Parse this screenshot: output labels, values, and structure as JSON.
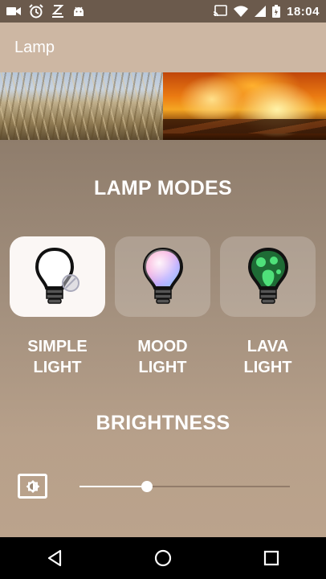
{
  "status_bar": {
    "time": "18:04",
    "left_icons": [
      "video-camera-icon",
      "alarm-clock-icon",
      "sleep-icon",
      "android-icon"
    ],
    "right_icons": [
      "cast-icon",
      "wifi-icon",
      "signal-icon",
      "battery-icon"
    ]
  },
  "app_bar": {
    "title": "Lamp"
  },
  "hero": {
    "images": [
      "grass-field-image",
      "fire-image"
    ]
  },
  "lamp_modes": {
    "title": "LAMP MODES",
    "modes": [
      {
        "label": "SIMPLE\nLIGHT",
        "icon": "simple-light-bulb-icon",
        "selected": true
      },
      {
        "label": "MOOD\nLIGHT",
        "icon": "mood-light-bulb-icon",
        "selected": false
      },
      {
        "label": "LAVA\nLIGHT",
        "icon": "lava-light-bulb-icon",
        "selected": false
      }
    ]
  },
  "brightness": {
    "title": "BRIGHTNESS",
    "icon": "brightness-icon",
    "value": 0.32
  },
  "nav_bar": {
    "buttons": [
      "back-icon",
      "home-icon",
      "recents-icon"
    ]
  },
  "colors": {
    "status_bar": "#6b5a4c",
    "app_bar": "#cdb7a3",
    "card_selected": "#fbf7f5",
    "text": "#ffffff"
  }
}
